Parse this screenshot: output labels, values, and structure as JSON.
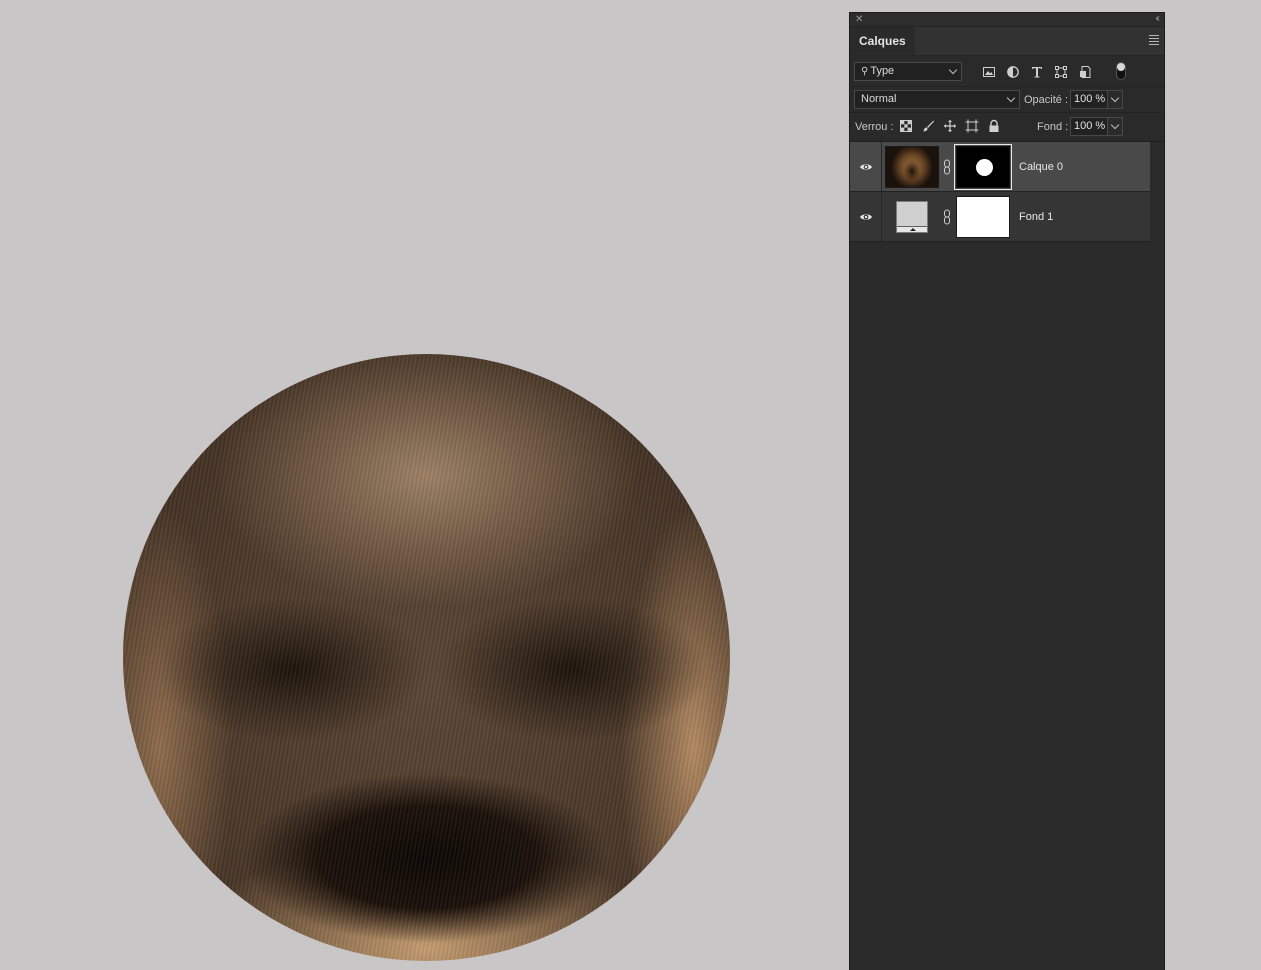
{
  "panel": {
    "title": "Calques",
    "filter": {
      "label": "Type",
      "icon": "search-icon"
    },
    "blend_mode": "Normal",
    "opacity_label": "Opacité :",
    "opacity_value": "100 %",
    "lock_label": "Verrou :",
    "fill_label": "Fond :",
    "fill_value": "100 %"
  },
  "layers": [
    {
      "name": "Calque 0",
      "selected": true,
      "visible": true,
      "mask": "circle-mask"
    },
    {
      "name": "Fond 1",
      "selected": false,
      "visible": true,
      "mask": "white-mask"
    }
  ]
}
